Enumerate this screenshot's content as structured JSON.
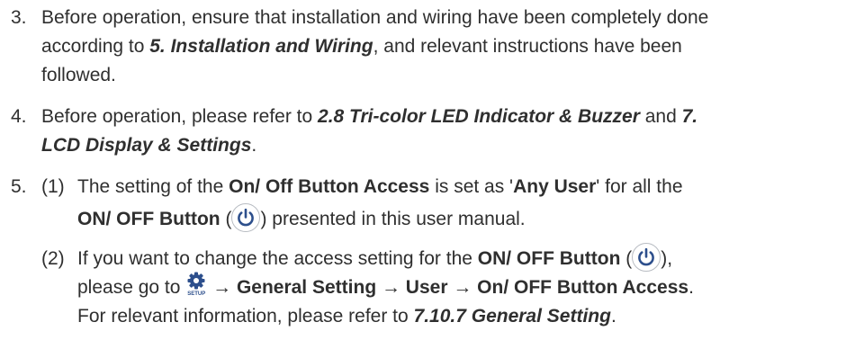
{
  "item3": {
    "number": "3.",
    "t1": "Before operation, ensure that installation and wiring have been completely done",
    "t2": "according to ",
    "ref": "5. Installation and Wiring",
    "t3": ", and relevant instructions have been",
    "t4": "followed."
  },
  "item4": {
    "number": "4.",
    "t1": "Before operation, please refer to ",
    "ref1": "2.8 Tri-color LED Indicator & Buzzer",
    "t2": " and ",
    "ref2a": "7.",
    "ref2b": "LCD Display & Settings",
    "t3": "."
  },
  "item5": {
    "number": "5.",
    "sub1": {
      "label": "(1)",
      "t1": "The setting of the ",
      "b1": "On/ Off Button Access",
      "t2": " is set as '",
      "b2": "Any User",
      "t3": "' for all the",
      "b3": "ON/ OFF Button",
      "t4": " (",
      "t5": ") presented in this user manual."
    },
    "sub2": {
      "label": "(2)",
      "t1": "If you want to change the access setting for the ",
      "b1": "ON/ OFF Button",
      "t2": " (",
      "t3": "),",
      "t4": "please go to ",
      "icon_label": "SETUP",
      "arrow": " → ",
      "path": "General Setting → User → On/ OFF Button Access",
      "t5": ".",
      "t6": "For relevant information, please refer to ",
      "ref": "7.10.7 General Setting",
      "t7": "."
    }
  },
  "colors": {
    "text": "#2f2f2f",
    "icon_blue": "#2d4f8c",
    "ring": "#b8bcc2"
  },
  "icons": [
    "power-icon",
    "setup-gear-icon"
  ]
}
